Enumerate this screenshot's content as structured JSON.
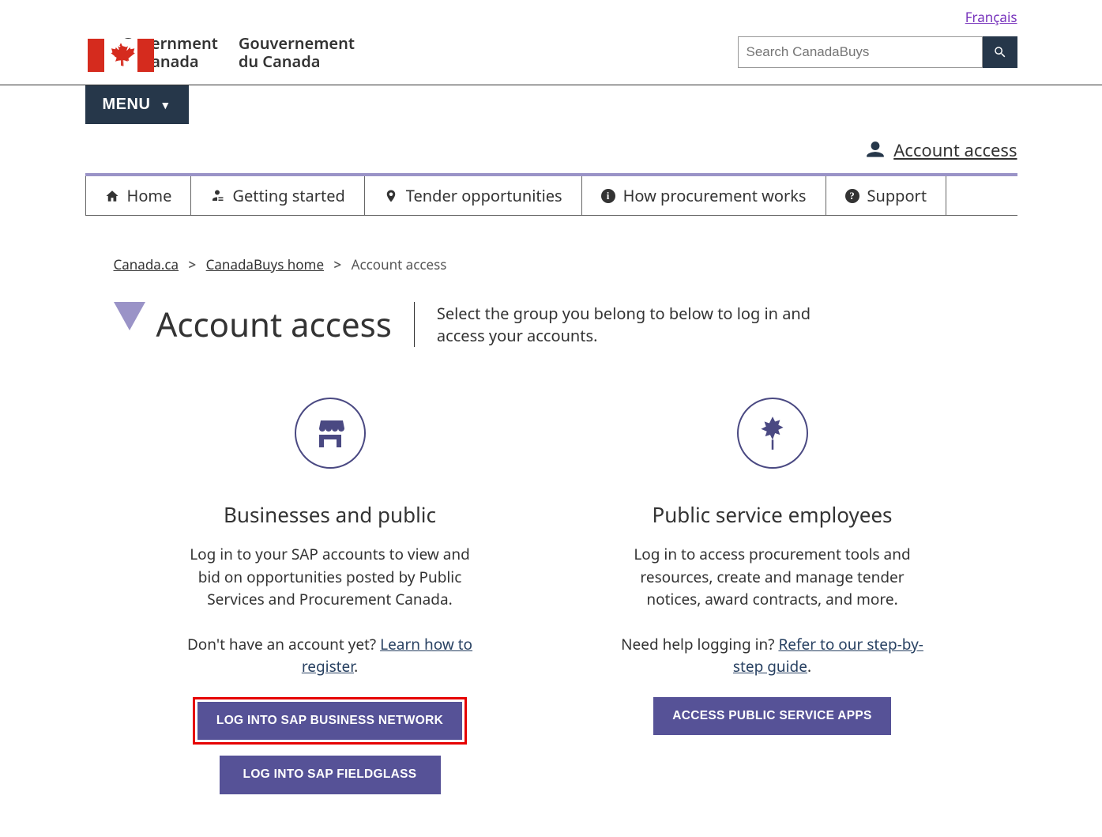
{
  "lang_link": "Français",
  "goc": {
    "en1": "Government",
    "en2": "of Canada",
    "fr1": "Gouvernement",
    "fr2": "du Canada"
  },
  "search": {
    "placeholder": "Search CanadaBuys"
  },
  "menu_label": "MENU",
  "account_access_link": "Account access",
  "tabs": {
    "home": "Home",
    "getting": "Getting started",
    "tender": "Tender opportunities",
    "how": "How procurement works",
    "support": "Support"
  },
  "breadcrumbs": {
    "canada": "Canada.ca",
    "cbhome": "CanadaBuys home",
    "current": "Account access"
  },
  "page_title": "Account access",
  "page_desc": "Select the group you belong to below to log in and access your accounts.",
  "card_business": {
    "title": "Businesses and public",
    "desc": "Log in to your SAP accounts to view and bid on opportunities posted by Public Services and Procurement Canada.",
    "help_pre": "Don't have an account yet? ",
    "help_link": "Learn how to register",
    "help_post": ".",
    "btn1": "LOG INTO SAP BUSINESS NETWORK",
    "btn2": "LOG INTO SAP FIELDGLASS"
  },
  "card_public": {
    "title": "Public service employees",
    "desc": "Log in to access procurement tools and resources, create and manage tender notices, award contracts, and more.",
    "help_pre": "Need help logging in? ",
    "help_link": "Refer to our step-by-step guide",
    "help_post": ".",
    "btn1": "ACCESS PUBLIC SERVICE APPS"
  }
}
